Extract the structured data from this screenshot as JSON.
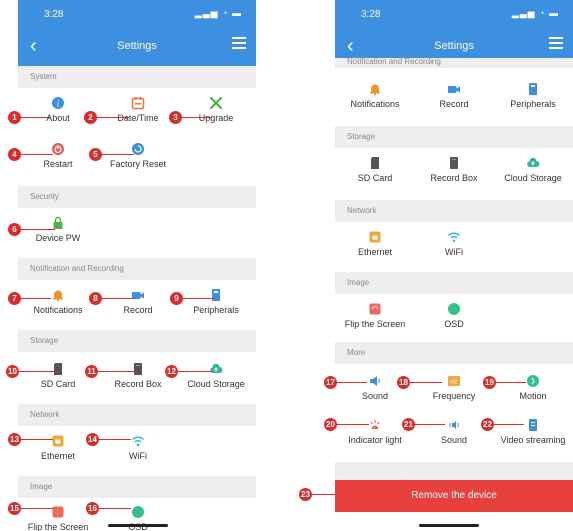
{
  "left": {
    "status_time": "3:28",
    "title": "Settings",
    "sections": {
      "system": "System",
      "security": "Security",
      "notif": "Notification and Recording",
      "storage": "Storage",
      "network": "Network",
      "image": "Image"
    },
    "items": {
      "about": "About",
      "datetime": "Date/Time",
      "upgrade": "Upgrade",
      "restart": "Restart",
      "factory": "Factory Reset",
      "devicepw": "Device PW",
      "notifications": "Notifications",
      "record": "Record",
      "peripherals": "Peripherals",
      "sdcard": "SD Card",
      "recordbox": "Record Box",
      "cloud": "Cloud Storage",
      "ethernet": "Ethernet",
      "wifi": "WiFi",
      "flip_partial": "Flip the Screen",
      "osd_partial": "OSD"
    },
    "badges": [
      "1",
      "2",
      "3",
      "4",
      "5",
      "6",
      "7",
      "8",
      "9",
      "10",
      "11",
      "12",
      "13",
      "14",
      "15",
      "16"
    ]
  },
  "right": {
    "status_time": "3:28",
    "title": "Settings",
    "sections": {
      "notif_partial": "Notification and Recording",
      "storage": "Storage",
      "network": "Network",
      "image": "Image",
      "more": "More"
    },
    "items": {
      "notifications": "Notifications",
      "record": "Record",
      "peripherals": "Peripherals",
      "sdcard": "SD Card",
      "recordbox": "Record Box",
      "cloud": "Cloud Storage",
      "ethernet": "Ethernet",
      "wifi": "WiFi",
      "flip": "Flip the Screen",
      "osd": "OSD",
      "sound": "Sound",
      "frequency": "Frequency",
      "motion": "Motion",
      "indicator": "Indicator light",
      "sound2": "Sound",
      "video": "Video streaming"
    },
    "remove": "Remove the device",
    "badges": [
      "17",
      "18",
      "19",
      "20",
      "21",
      "22",
      "23"
    ]
  }
}
